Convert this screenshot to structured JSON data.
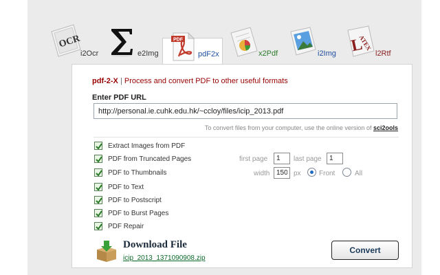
{
  "tabs": [
    {
      "label": "i2Ocr",
      "icon": "ocr-icon"
    },
    {
      "label": "e2Img",
      "icon": "sigma-icon"
    },
    {
      "label": "pdF2x",
      "icon": "pdf-icon"
    },
    {
      "label": "x2Pdf",
      "icon": "chart-doc-icon"
    },
    {
      "label": "i2Img",
      "icon": "image-doc-icon"
    },
    {
      "label": "l2Rtf",
      "icon": "latex-icon"
    }
  ],
  "header": {
    "brand": "pdf-2-X",
    "separator": "|",
    "description": "Process and convert PDF to other useful formats"
  },
  "url": {
    "label": "Enter PDF URL",
    "value": "http://personal.ie.cuhk.edu.hk/~ccloy/files/icip_2013.pdf"
  },
  "hint": {
    "text": "To convert files from your computer, use the online version of",
    "link": "sci2ools"
  },
  "options": [
    {
      "label": "Extract Images from PDF",
      "checked": true
    },
    {
      "label": "PDF from Truncated Pages",
      "checked": true
    },
    {
      "label": "PDF to Thumbnails",
      "checked": true
    },
    {
      "label": "PDF to Text",
      "checked": true
    },
    {
      "label": "PDF to Postscript",
      "checked": true
    },
    {
      "label": "PDF to Burst Pages",
      "checked": true
    },
    {
      "label": "PDF Repair",
      "checked": true
    }
  ],
  "pages": {
    "first_label": "first page",
    "first_value": "1",
    "last_label": "last page",
    "last_value": "1"
  },
  "thumb": {
    "width_label": "width",
    "width_value": "150",
    "unit": "px",
    "front_label": "Front",
    "all_label": "All",
    "selected": "Front"
  },
  "download": {
    "title": "Download File",
    "filename": "icip_2013_1371090908.zip"
  },
  "convert_label": "Convert",
  "colors": {
    "brand": "#990000",
    "checkbox_fill": "#e8f6e3",
    "link_green": "#0a6a2a",
    "radio_selected": "#1d6bc0"
  }
}
